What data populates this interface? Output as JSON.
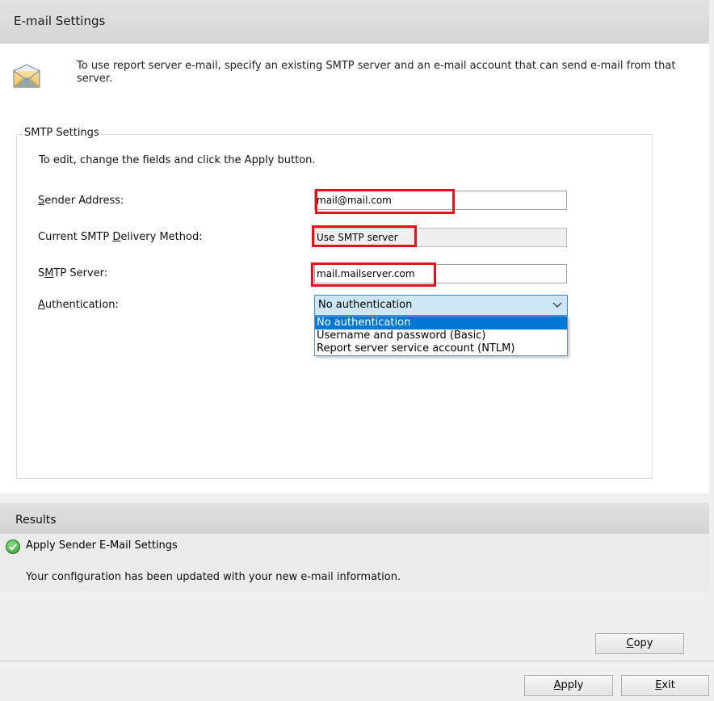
{
  "header": {
    "title": "E-mail Settings"
  },
  "intro": {
    "text": "To use report server e-mail, specify an existing SMTP server and an e-mail account that can send e-mail from that server.",
    "icon": "mail-envelope-icon"
  },
  "smtp": {
    "legend": "SMTP Settings",
    "hint": "To edit, change the fields and click the Apply button.",
    "sender": {
      "label_key": "S",
      "label_rest": "ender Address:",
      "value": "mail@mail.com"
    },
    "delivery": {
      "label_pre": "Current SMTP ",
      "label_key": "D",
      "label_rest": "elivery Method:",
      "value": "Use SMTP server"
    },
    "server": {
      "label_pre": "S",
      "label_key": "M",
      "label_rest": "TP Server:",
      "value": "mail.mailserver.com"
    },
    "auth": {
      "label_key": "A",
      "label_rest": "uthentication:",
      "selected": "No authentication",
      "options": [
        "No authentication",
        "Username and password (Basic)",
        "Report server service account (NTLM)"
      ]
    },
    "highlight_color": "#e3121b"
  },
  "results": {
    "title": "Results",
    "item_title": "Apply Sender E-Mail Settings",
    "item_detail": "Your configuration has been updated with your new e-mail information.",
    "status_icon": "success-check-icon",
    "status_color": "#3aa43a"
  },
  "buttons": {
    "copy_key": "C",
    "copy_rest": "opy",
    "apply_key": "A",
    "apply_rest": "pply",
    "exit_key": "E",
    "exit_rest": "xit"
  }
}
